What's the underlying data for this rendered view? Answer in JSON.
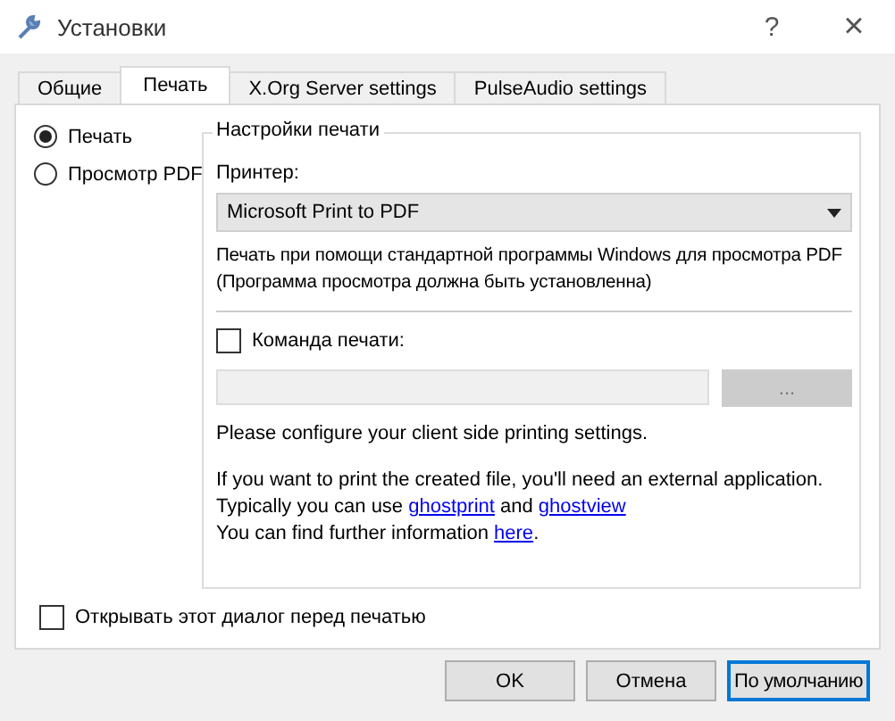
{
  "window": {
    "title": "Установки",
    "help_button": "?",
    "close_button": "×"
  },
  "tabs": [
    {
      "label": "Общие",
      "selected": false
    },
    {
      "label": "Печать",
      "selected": true
    },
    {
      "label": "X.Org Server settings",
      "selected": false
    },
    {
      "label": "PulseAudio settings",
      "selected": false
    }
  ],
  "print_mode": [
    {
      "label": "Печать",
      "selected": true
    },
    {
      "label": "Просмотр PDF",
      "selected": false
    }
  ],
  "print_settings": {
    "title": "Настройки печати",
    "printer_label": "Принтер:",
    "printer_value": "Microsoft Print to PDF",
    "description": [
      "Печать при помощи стандартной программы Windows для просмотра PDF",
      "(Программа просмотра должна быть установленна)"
    ],
    "command": {
      "label": "Команда печати:",
      "checked": false
    },
    "command_field": {
      "disabled": true
    },
    "browse_button": {
      "label": "...",
      "disabled": true
    },
    "note": "Please configure your client side printing settings.",
    "info": [
      [
        {
          "kind": "text",
          "text": "If you want to print the created file, you'll need an external application."
        }
      ],
      [
        {
          "kind": "text",
          "text": "Typically you can use "
        },
        {
          "kind": "link",
          "text": "ghostprint"
        },
        {
          "kind": "text",
          "text": " and "
        },
        {
          "kind": "link",
          "text": "ghostview"
        }
      ],
      [
        {
          "kind": "text",
          "text": "You can find further information "
        },
        {
          "kind": "link",
          "text": "here"
        },
        {
          "kind": "text",
          "text": "."
        }
      ]
    ]
  },
  "open_dialog": {
    "label": "Открывать этот диалог перед печатью",
    "checked": false
  },
  "buttons": [
    {
      "label": "OK",
      "focused": false
    },
    {
      "label": "Отмена",
      "focused": false
    },
    {
      "label": "По умолчанию",
      "focused": true
    }
  ]
}
